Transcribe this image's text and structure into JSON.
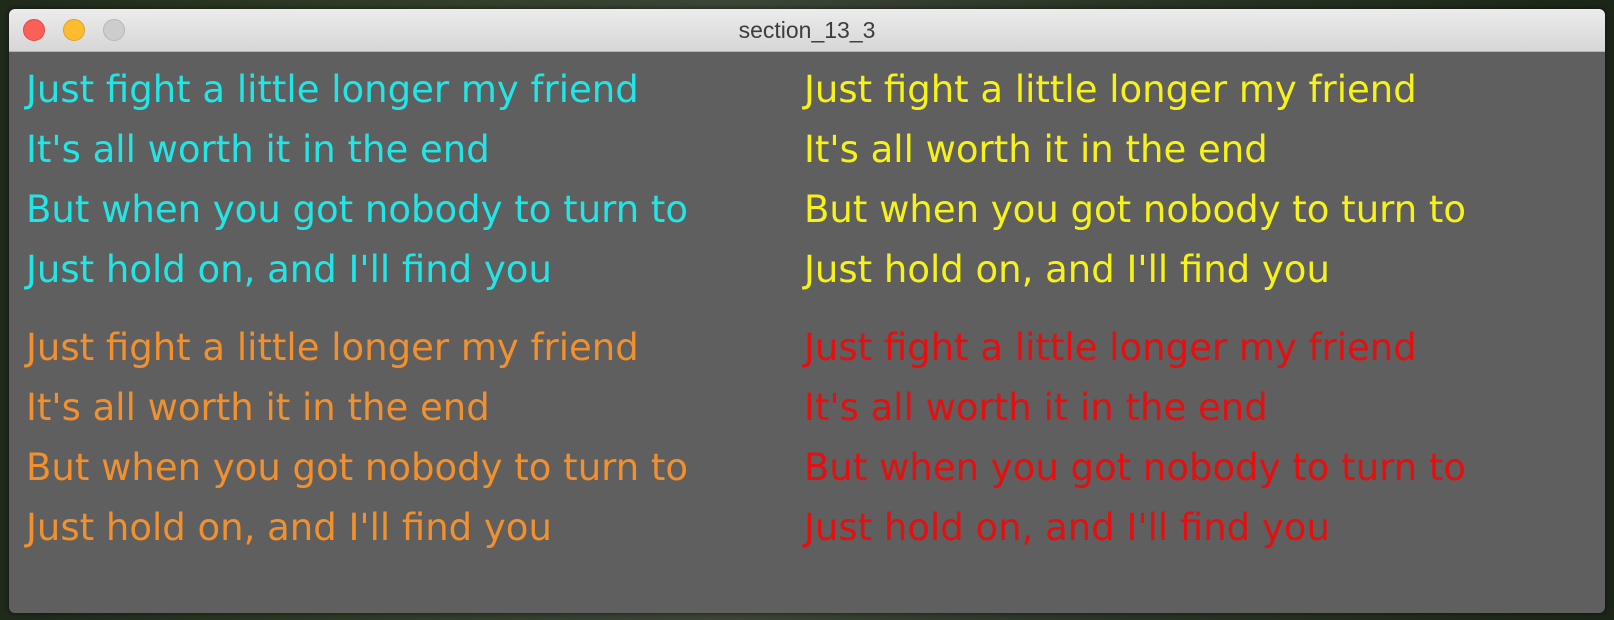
{
  "window": {
    "title": "section_13_3"
  },
  "lyrics": [
    "Just fight a little longer my friend",
    "It's all worth it in the end",
    "But when you got nobody to turn to",
    "Just hold on, and I'll find you"
  ],
  "colors": {
    "background": "#5f5f5f",
    "top_left": "#22e6e6",
    "top_right": "#f6f21a",
    "bottom_left": "#f0902e",
    "bottom_right": "#e60e0e"
  }
}
